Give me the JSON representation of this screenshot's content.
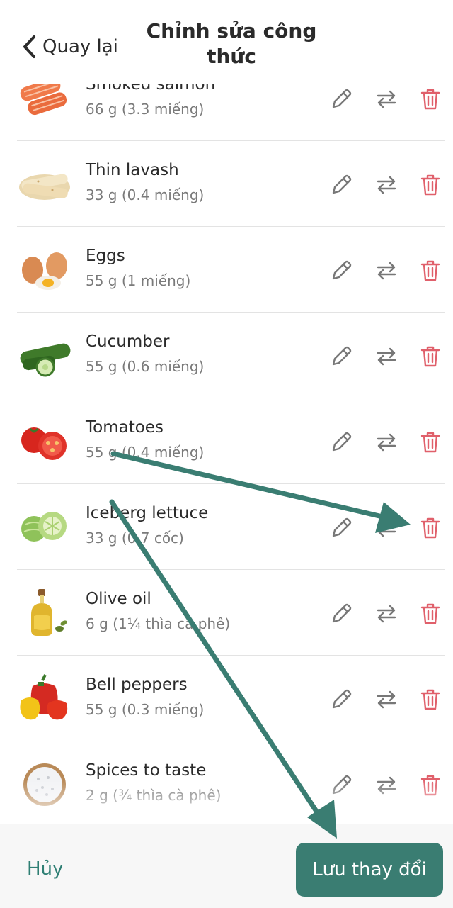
{
  "header": {
    "back_label": "Quay lại",
    "title": "Chỉnh sửa công thức"
  },
  "ingredients": [
    {
      "name": "Smoked salmon",
      "amount": "66 g (3.3 miếng)",
      "image": "salmon-image"
    },
    {
      "name": "Thin lavash",
      "amount": "33 g (0.4 miếng)",
      "image": "lavash-image"
    },
    {
      "name": "Eggs",
      "amount": "55 g (1 miếng)",
      "image": "eggs-image"
    },
    {
      "name": "Cucumber",
      "amount": "55 g (0.6 miếng)",
      "image": "cucumber-image"
    },
    {
      "name": "Tomatoes",
      "amount": "55 g (0.4 miếng)",
      "image": "tomatoes-image"
    },
    {
      "name": "Iceberg lettuce",
      "amount": "33 g (0.7 cốc)",
      "image": "lettuce-image"
    },
    {
      "name": "Olive oil",
      "amount": "6 g (1¼ thìa cà phê)",
      "image": "olive-oil-image"
    },
    {
      "name": "Bell peppers",
      "amount": "55 g (0.3 miếng)",
      "image": "bell-peppers-image"
    },
    {
      "name": "Spices to taste",
      "amount": "2 g (¾ thìa cà phê)",
      "image": "salt-image"
    }
  ],
  "row_actions": {
    "edit_icon": "pencil-icon",
    "swap_icon": "swap-arrows-icon",
    "delete_icon": "trash-icon"
  },
  "footer": {
    "cancel_label": "Hủy",
    "save_label": "Lưu thay đổi"
  },
  "colors": {
    "accent": "#3a7d72",
    "delete": "#e0606b",
    "icon_gray": "#777777",
    "annotation_arrow": "#3a7d72"
  },
  "annotations": [
    {
      "type": "arrow",
      "from": "Tomatoes",
      "to": "delete-icon of Iceberg lettuce"
    },
    {
      "type": "arrow",
      "from": "Iceberg lettuce",
      "to": "save-button"
    }
  ]
}
